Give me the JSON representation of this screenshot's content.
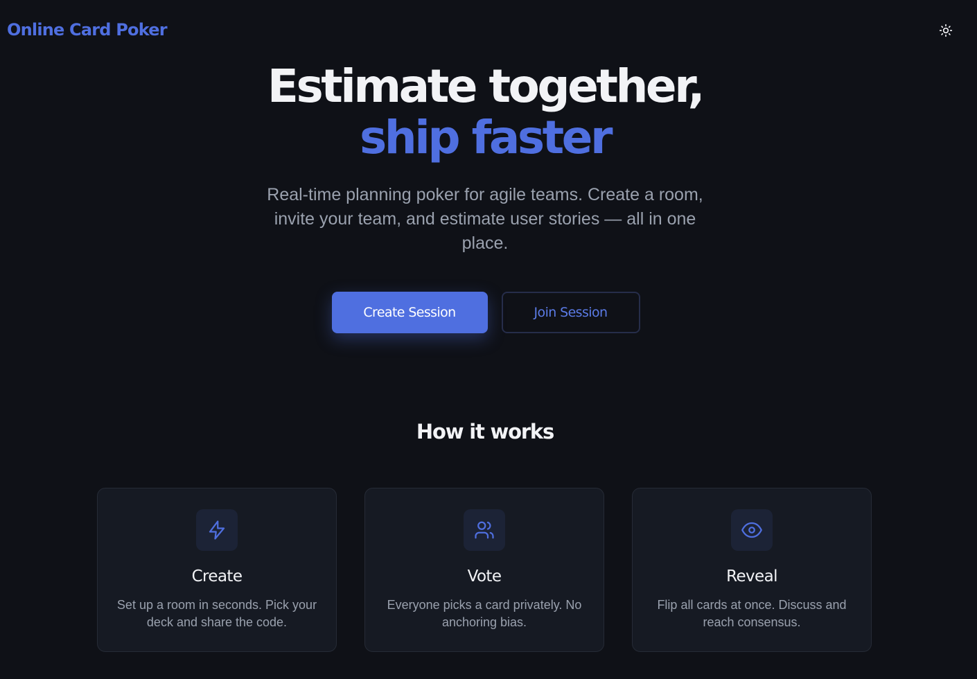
{
  "header": {
    "brand": "Online Card Poker",
    "theme_toggle_icon": "sun-icon"
  },
  "hero": {
    "title_line1": "Estimate together,",
    "title_line2": "ship faster",
    "subtitle": "Real-time planning poker for agile teams. Create a room, invite your team, and estimate user stories — all in one place.",
    "primary_button": "Create Session",
    "secondary_button": "Join Session"
  },
  "how_it_works": {
    "heading": "How it works",
    "steps": [
      {
        "icon": "lightning-icon",
        "title": "Create",
        "description": "Set up a room in seconds. Pick your deck and share the code."
      },
      {
        "icon": "users-icon",
        "title": "Vote",
        "description": "Everyone picks a card privately. No anchoring bias."
      },
      {
        "icon": "eye-icon",
        "title": "Reveal",
        "description": "Flip all cards at once. Discuss and reach consensus."
      }
    ]
  },
  "colors": {
    "background": "#0f1117",
    "accent": "#4f6fe0",
    "card_background": "#161a23",
    "muted_text": "#9aa1ae"
  }
}
